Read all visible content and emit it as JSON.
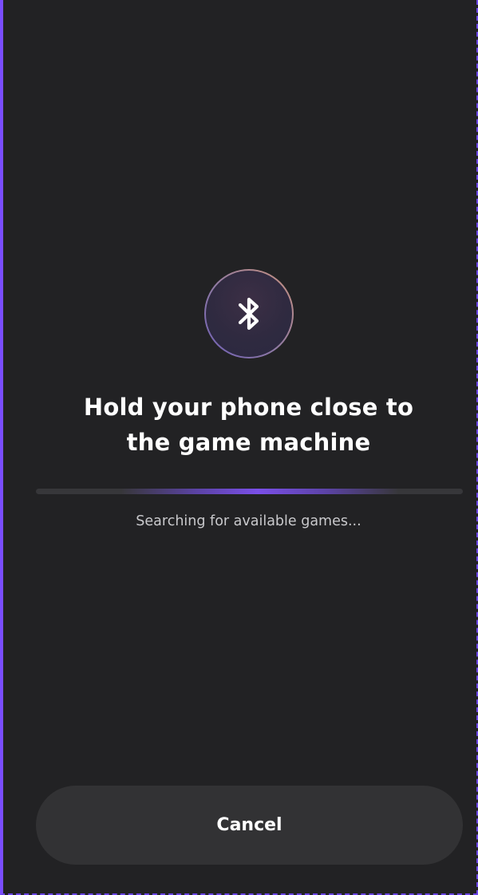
{
  "pairing": {
    "icon": "bluetooth-icon",
    "title_line1": "Hold your phone close to",
    "title_line2": "the game machine",
    "status": "Searching for available games...",
    "cancel_label": "Cancel"
  },
  "colors": {
    "background": "#222224",
    "accent": "#7a4dff",
    "button": "#323234",
    "text": "#ffffff",
    "muted_text": "#c9c9cc"
  }
}
